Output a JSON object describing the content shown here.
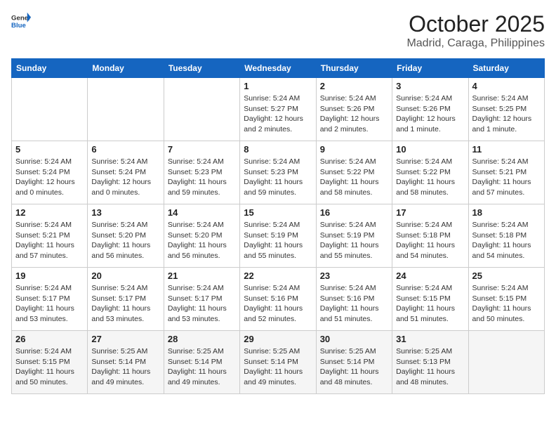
{
  "header": {
    "logo_general": "General",
    "logo_blue": "Blue",
    "month": "October 2025",
    "location": "Madrid, Caraga, Philippines"
  },
  "days_of_week": [
    "Sunday",
    "Monday",
    "Tuesday",
    "Wednesday",
    "Thursday",
    "Friday",
    "Saturday"
  ],
  "weeks": [
    [
      {
        "day": "",
        "info": ""
      },
      {
        "day": "",
        "info": ""
      },
      {
        "day": "",
        "info": ""
      },
      {
        "day": "1",
        "info": "Sunrise: 5:24 AM\nSunset: 5:27 PM\nDaylight: 12 hours\nand 2 minutes."
      },
      {
        "day": "2",
        "info": "Sunrise: 5:24 AM\nSunset: 5:26 PM\nDaylight: 12 hours\nand 2 minutes."
      },
      {
        "day": "3",
        "info": "Sunrise: 5:24 AM\nSunset: 5:26 PM\nDaylight: 12 hours\nand 1 minute."
      },
      {
        "day": "4",
        "info": "Sunrise: 5:24 AM\nSunset: 5:25 PM\nDaylight: 12 hours\nand 1 minute."
      }
    ],
    [
      {
        "day": "5",
        "info": "Sunrise: 5:24 AM\nSunset: 5:24 PM\nDaylight: 12 hours\nand 0 minutes."
      },
      {
        "day": "6",
        "info": "Sunrise: 5:24 AM\nSunset: 5:24 PM\nDaylight: 12 hours\nand 0 minutes."
      },
      {
        "day": "7",
        "info": "Sunrise: 5:24 AM\nSunset: 5:23 PM\nDaylight: 11 hours\nand 59 minutes."
      },
      {
        "day": "8",
        "info": "Sunrise: 5:24 AM\nSunset: 5:23 PM\nDaylight: 11 hours\nand 59 minutes."
      },
      {
        "day": "9",
        "info": "Sunrise: 5:24 AM\nSunset: 5:22 PM\nDaylight: 11 hours\nand 58 minutes."
      },
      {
        "day": "10",
        "info": "Sunrise: 5:24 AM\nSunset: 5:22 PM\nDaylight: 11 hours\nand 58 minutes."
      },
      {
        "day": "11",
        "info": "Sunrise: 5:24 AM\nSunset: 5:21 PM\nDaylight: 11 hours\nand 57 minutes."
      }
    ],
    [
      {
        "day": "12",
        "info": "Sunrise: 5:24 AM\nSunset: 5:21 PM\nDaylight: 11 hours\nand 57 minutes."
      },
      {
        "day": "13",
        "info": "Sunrise: 5:24 AM\nSunset: 5:20 PM\nDaylight: 11 hours\nand 56 minutes."
      },
      {
        "day": "14",
        "info": "Sunrise: 5:24 AM\nSunset: 5:20 PM\nDaylight: 11 hours\nand 56 minutes."
      },
      {
        "day": "15",
        "info": "Sunrise: 5:24 AM\nSunset: 5:19 PM\nDaylight: 11 hours\nand 55 minutes."
      },
      {
        "day": "16",
        "info": "Sunrise: 5:24 AM\nSunset: 5:19 PM\nDaylight: 11 hours\nand 55 minutes."
      },
      {
        "day": "17",
        "info": "Sunrise: 5:24 AM\nSunset: 5:18 PM\nDaylight: 11 hours\nand 54 minutes."
      },
      {
        "day": "18",
        "info": "Sunrise: 5:24 AM\nSunset: 5:18 PM\nDaylight: 11 hours\nand 54 minutes."
      }
    ],
    [
      {
        "day": "19",
        "info": "Sunrise: 5:24 AM\nSunset: 5:17 PM\nDaylight: 11 hours\nand 53 minutes."
      },
      {
        "day": "20",
        "info": "Sunrise: 5:24 AM\nSunset: 5:17 PM\nDaylight: 11 hours\nand 53 minutes."
      },
      {
        "day": "21",
        "info": "Sunrise: 5:24 AM\nSunset: 5:17 PM\nDaylight: 11 hours\nand 53 minutes."
      },
      {
        "day": "22",
        "info": "Sunrise: 5:24 AM\nSunset: 5:16 PM\nDaylight: 11 hours\nand 52 minutes."
      },
      {
        "day": "23",
        "info": "Sunrise: 5:24 AM\nSunset: 5:16 PM\nDaylight: 11 hours\nand 51 minutes."
      },
      {
        "day": "24",
        "info": "Sunrise: 5:24 AM\nSunset: 5:15 PM\nDaylight: 11 hours\nand 51 minutes."
      },
      {
        "day": "25",
        "info": "Sunrise: 5:24 AM\nSunset: 5:15 PM\nDaylight: 11 hours\nand 50 minutes."
      }
    ],
    [
      {
        "day": "26",
        "info": "Sunrise: 5:24 AM\nSunset: 5:15 PM\nDaylight: 11 hours\nand 50 minutes."
      },
      {
        "day": "27",
        "info": "Sunrise: 5:25 AM\nSunset: 5:14 PM\nDaylight: 11 hours\nand 49 minutes."
      },
      {
        "day": "28",
        "info": "Sunrise: 5:25 AM\nSunset: 5:14 PM\nDaylight: 11 hours\nand 49 minutes."
      },
      {
        "day": "29",
        "info": "Sunrise: 5:25 AM\nSunset: 5:14 PM\nDaylight: 11 hours\nand 49 minutes."
      },
      {
        "day": "30",
        "info": "Sunrise: 5:25 AM\nSunset: 5:14 PM\nDaylight: 11 hours\nand 48 minutes."
      },
      {
        "day": "31",
        "info": "Sunrise: 5:25 AM\nSunset: 5:13 PM\nDaylight: 11 hours\nand 48 minutes."
      },
      {
        "day": "",
        "info": ""
      }
    ]
  ]
}
